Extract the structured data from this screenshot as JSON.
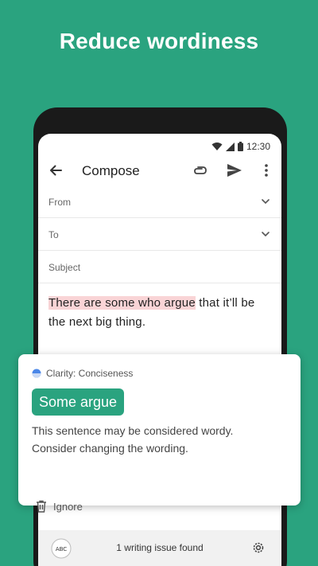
{
  "headline": "Reduce wordiness",
  "status_bar": {
    "time": "12:30"
  },
  "compose": {
    "title": "Compose",
    "fields": {
      "from": "From",
      "to": "To",
      "subject": "Subject"
    },
    "body_highlight": "There are some who argue",
    "body_rest": " that it’ll be the next big thing."
  },
  "suggestion": {
    "category": "Clarity: Conciseness",
    "replacement": "Some argue",
    "explanation": "This sentence may be considered wordy. Consider changing the wording.",
    "ignore_label": "Ignore"
  },
  "bottom_bar": {
    "abc_label": "ABC",
    "issues_text": "1 writing issue found"
  },
  "colors": {
    "brand_green": "#2aa37f",
    "highlight": "#f9d4d6",
    "category_blue": "#4a86e8"
  }
}
